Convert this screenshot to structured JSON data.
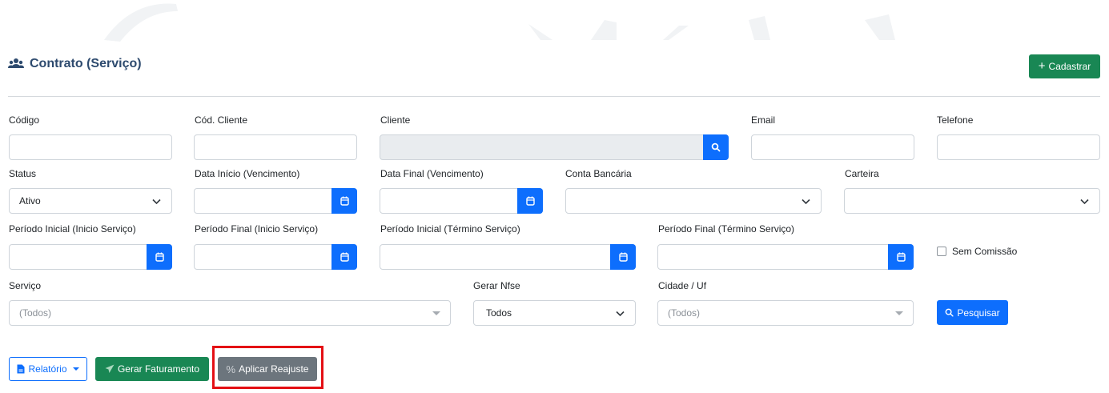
{
  "header": {
    "title": "Contrato (Serviço)",
    "cadastrar_label": "Cadastrar"
  },
  "filters": {
    "codigo": {
      "label": "Código",
      "value": ""
    },
    "cod_cliente": {
      "label": "Cód. Cliente",
      "value": ""
    },
    "cliente": {
      "label": "Cliente",
      "value": ""
    },
    "email": {
      "label": "Email",
      "value": ""
    },
    "telefone": {
      "label": "Telefone",
      "value": ""
    },
    "status": {
      "label": "Status",
      "value": "Ativo"
    },
    "data_inicio_venc": {
      "label": "Data Início (Vencimento)",
      "value": ""
    },
    "data_final_venc": {
      "label": "Data Final (Vencimento)",
      "value": ""
    },
    "conta_bancaria": {
      "label": "Conta Bancária",
      "value": ""
    },
    "carteira": {
      "label": "Carteira",
      "value": ""
    },
    "periodo_inicial_inicio": {
      "label": "Período Inicial (Inicio Serviço)",
      "value": ""
    },
    "periodo_final_inicio": {
      "label": "Período Final (Inicio Serviço)",
      "value": ""
    },
    "periodo_inicial_termino": {
      "label": "Período Inicial (Término Serviço)",
      "value": ""
    },
    "periodo_final_termino": {
      "label": "Período Final (Término Serviço)",
      "value": ""
    },
    "sem_comissao": {
      "label": "Sem Comissão",
      "checked": false
    },
    "servico": {
      "label": "Serviço",
      "placeholder": "(Todos)"
    },
    "gerar_nfse": {
      "label": "Gerar Nfse",
      "value": "Todos"
    },
    "cidade_uf": {
      "label": "Cidade / Uf",
      "placeholder": "(Todos)"
    },
    "pesquisar_label": "Pesquisar"
  },
  "actions": {
    "relatorio_label": "Relatório",
    "gerar_faturamento_label": "Gerar Faturamento",
    "aplicar_reajuste_label": "Aplicar Reajuste"
  },
  "colors": {
    "primary": "#0d6efd",
    "success": "#198754",
    "secondary": "#6c757d",
    "title": "#2d4a6e",
    "highlight": "#e40f14"
  }
}
